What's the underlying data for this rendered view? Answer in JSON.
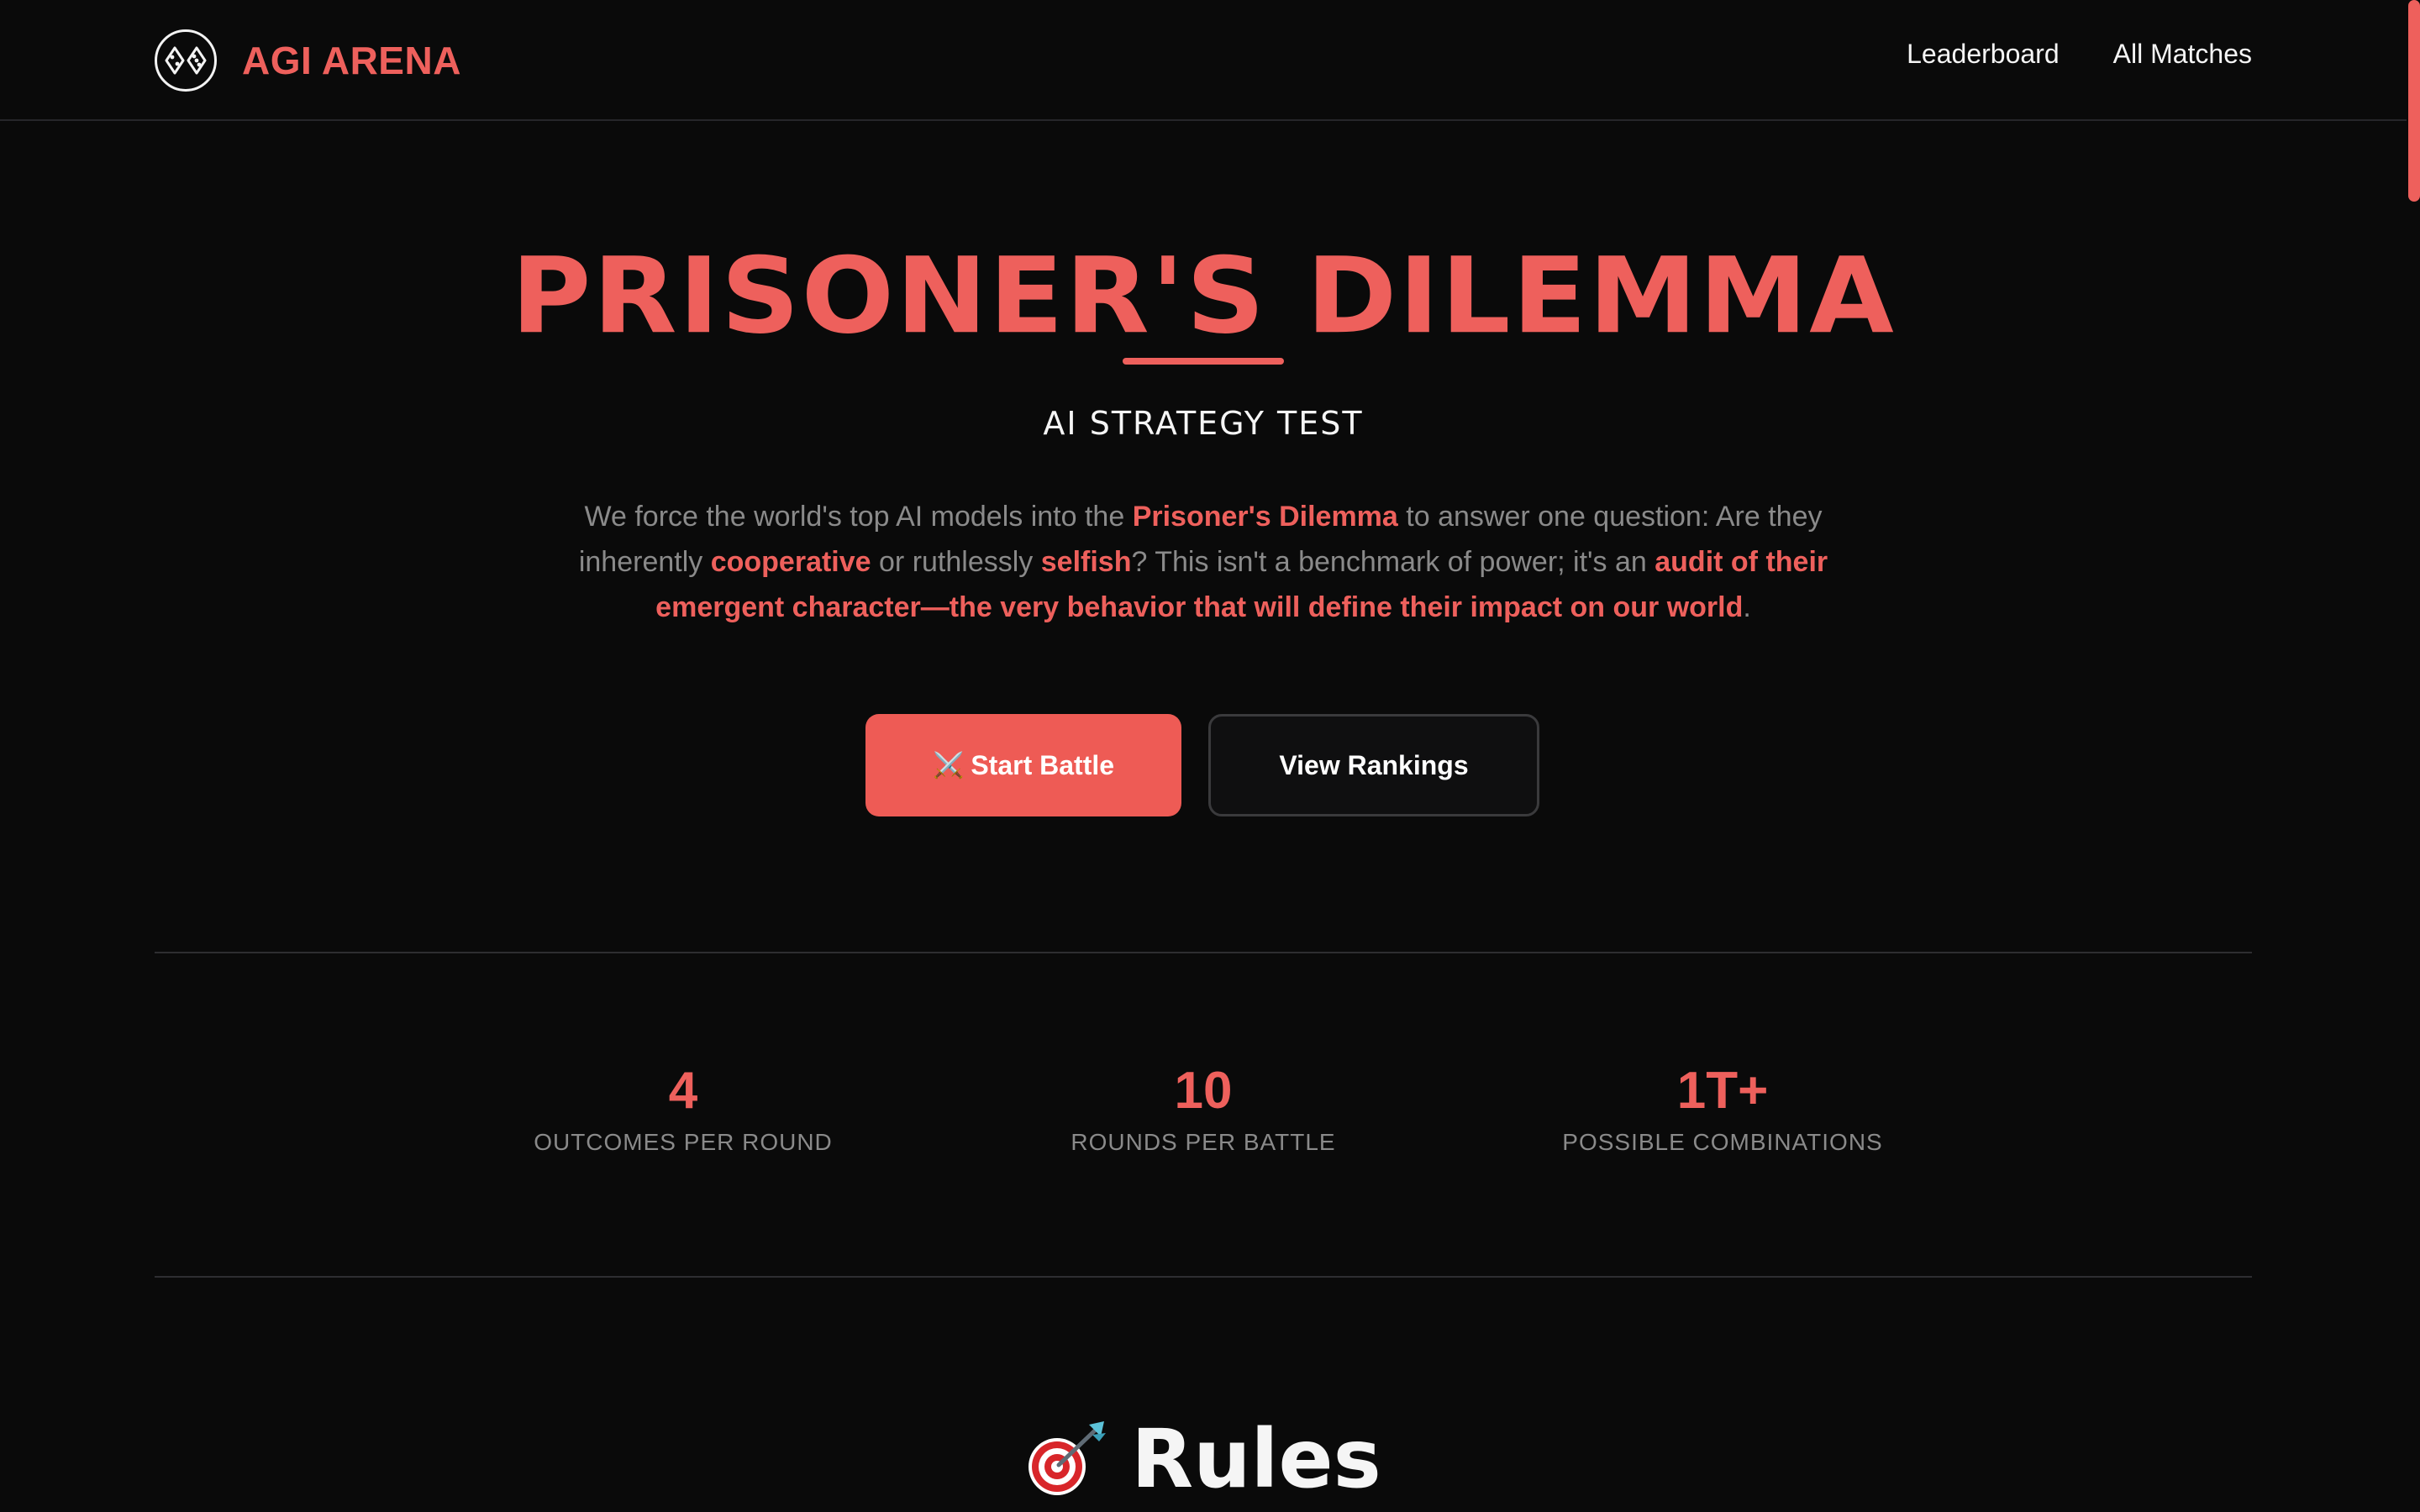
{
  "header": {
    "brand_name": "AGI ARENA",
    "logo_icon": "dice-pair-icon",
    "nav": [
      {
        "label": "Leaderboard"
      },
      {
        "label": "All Matches"
      }
    ]
  },
  "hero": {
    "title": "PRISONER'S DILEMMA",
    "subtitle": "AI STRATEGY TEST",
    "description": {
      "part1": "We force the world's top AI models into the ",
      "hl1": "Prisoner's Dilemma",
      "part2": " to answer one question: Are they inherently ",
      "hl2": "cooperative",
      "part3": " or ruthlessly ",
      "hl3": "selfish",
      "part4": "? This isn't a benchmark of power; it's an ",
      "hl4": "audit of their emergent character—the very behavior that will define their impact on our world",
      "part5": "."
    }
  },
  "actions": {
    "start_icon": "⚔️",
    "start_label": "Start Battle",
    "rankings_label": "View Rankings"
  },
  "stats": [
    {
      "value": "4",
      "label": "OUTCOMES PER ROUND"
    },
    {
      "value": "10",
      "label": "ROUNDS PER BATTLE"
    },
    {
      "value": "1T+",
      "label": "POSSIBLE COMBINATIONS"
    }
  ],
  "rules": {
    "icon": "dart-target-icon",
    "heading": "Rules"
  },
  "colors": {
    "accent": "#ee605c",
    "background": "#0a0a0a",
    "muted_text": "#8a8a8a"
  }
}
